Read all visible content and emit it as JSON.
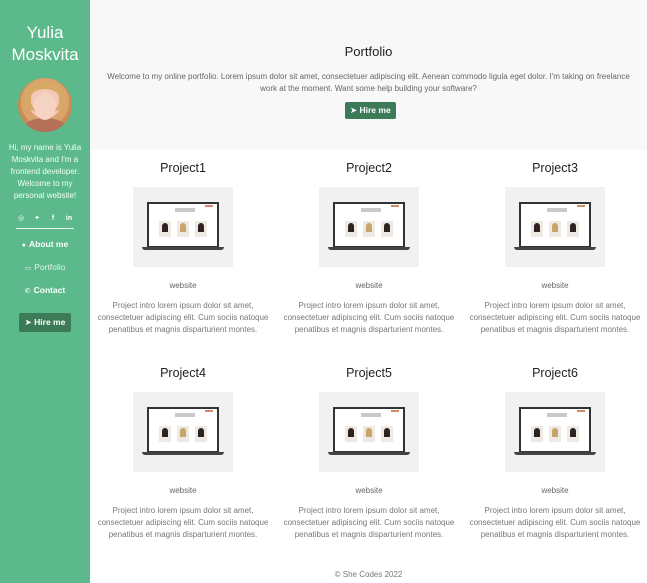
{
  "sidebar": {
    "name_line1": "Yulia",
    "name_line2": "Moskvita",
    "bio": "Hi, my name is Yulia Moskvita and I'm a frontend developer. Welcome to my personal website!",
    "socials": [
      {
        "icon": "instagram-icon",
        "glyph": "◎"
      },
      {
        "icon": "twitter-icon",
        "glyph": "✦"
      },
      {
        "icon": "facebook-icon",
        "glyph": "f"
      },
      {
        "icon": "linkedin-icon",
        "glyph": "in"
      }
    ],
    "nav": [
      {
        "label": "About me",
        "icon": "person-icon",
        "glyph": "●"
      },
      {
        "label": "Portfolio",
        "icon": "briefcase-icon",
        "glyph": "▭"
      },
      {
        "label": "Contact",
        "icon": "phone-icon",
        "glyph": "✆"
      }
    ],
    "hire_label": "Hire me",
    "hire_glyph": "➤"
  },
  "hero": {
    "title": "Portfolio",
    "text": "Welcome to my online portfolio. Lorem ipsum dolor sit amet, consectetuer adipiscing elit. Aenean commodo ligula eget dolor. I'm taking on freelance work at the moment. Want some help building your software?",
    "hire_label": "Hire me",
    "hire_glyph": "➤"
  },
  "projects": [
    {
      "title": "Project1",
      "link": "website",
      "desc": "Project intro lorem ipsum dolor sit amet, consectetuer adipiscing elit. Cum sociis natoque penatibus et magnis disparturient montes."
    },
    {
      "title": "Project2",
      "link": "website",
      "desc": "Project intro lorem ipsum dolor sit amet, consectetuer adipiscing elit. Cum sociis natoque penatibus et magnis disparturient montes."
    },
    {
      "title": "Project3",
      "link": "website",
      "desc": "Project intro lorem ipsum dolor sit amet, consectetuer adipiscing elit. Cum sociis natoque penatibus et magnis disparturient montes."
    },
    {
      "title": "Project4",
      "link": "website",
      "desc": "Project intro lorem ipsum dolor sit amet, consectetuer adipiscing elit. Cum sociis natoque penatibus et magnis disparturient montes."
    },
    {
      "title": "Project5",
      "link": "website",
      "desc": "Project intro lorem ipsum dolor sit amet, consectetuer adipiscing elit. Cum sociis natoque penatibus et magnis disparturient montes."
    },
    {
      "title": "Project6",
      "link": "website",
      "desc": "Project intro lorem ipsum dolor sit amet, consectetuer adipiscing elit. Cum sociis natoque penatibus et magnis disparturient montes."
    }
  ],
  "footer": {
    "text": "© She Codes 2022"
  },
  "colors": {
    "sidebar_bg": "#5bb98b",
    "button_bg": "#3d7a57",
    "hero_bg": "#f8f8f8"
  }
}
